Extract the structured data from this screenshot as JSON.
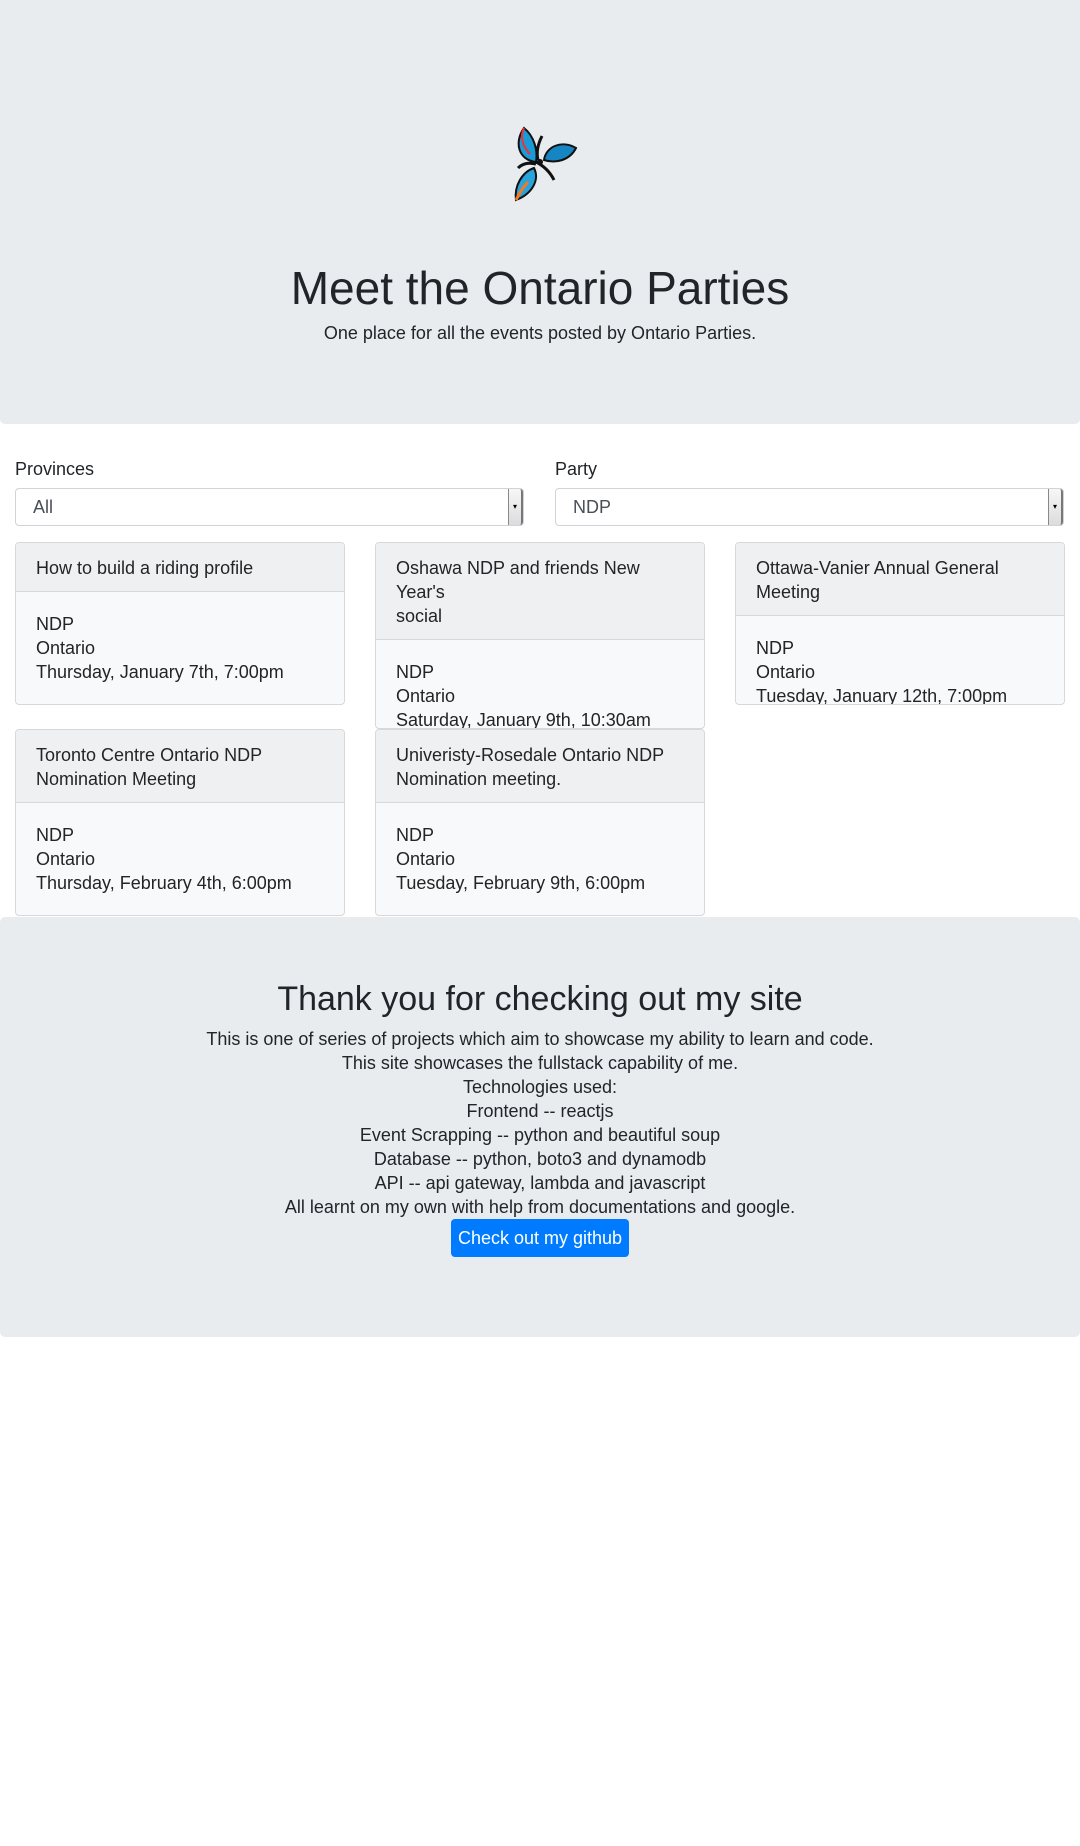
{
  "hero": {
    "title": "Meet the Ontario Parties",
    "subtitle": "One place for all the events posted by Ontario Parties."
  },
  "filters": {
    "provinces": {
      "label": "Provinces",
      "value": "All"
    },
    "party": {
      "label": "Party",
      "value": "NDP"
    }
  },
  "events": [
    {
      "title": "How to build a riding profile",
      "party": "NDP",
      "province": "Ontario",
      "date": "Thursday, January 7th, 7:00pm"
    },
    {
      "title_lines": [
        "Oshawa NDP and friends New Year's",
        "social"
      ],
      "party": "NDP",
      "province": "Ontario",
      "date": "Saturday, January 9th, 10:30am"
    },
    {
      "title": "Ottawa-Vanier Annual General Meeting",
      "party": "NDP",
      "province": "Ontario",
      "date": "Tuesday, January 12th, 7:00pm"
    },
    {
      "title_lines": [
        "Toronto Centre Ontario NDP",
        "Nomination Meeting"
      ],
      "party": "NDP",
      "province": "Ontario",
      "date": "Thursday, February 4th, 6:00pm"
    },
    {
      "title_lines": [
        "Univeristy-Rosedale Ontario NDP",
        "Nomination meeting."
      ],
      "party": "NDP",
      "province": "Ontario",
      "date": "Tuesday, February 9th, 6:00pm"
    }
  ],
  "footer": {
    "title": "Thank you for checking out my site",
    "lines": [
      "This is one of series of projects which aim to showcase my ability to learn and code.",
      "This site showcases the fullstack capability of me.",
      "Technologies used:",
      "Frontend -- reactjs",
      "Event Scrapping -- python and beautiful soup",
      "Database -- python, boto3 and dynamodb",
      "API -- api gateway, lambda and javascript",
      "All learnt on my own with help from documentations and google."
    ],
    "button_label": "Check out my github"
  },
  "colors": {
    "jumbotron_bg": "#e9ecef",
    "primary_button": "#007bff",
    "card_bg": "#f8f9fa",
    "text": "#212529"
  },
  "icons": {
    "logo": "ontario-trillium-logo-icon",
    "select_arrow": "caret-down-icon"
  }
}
